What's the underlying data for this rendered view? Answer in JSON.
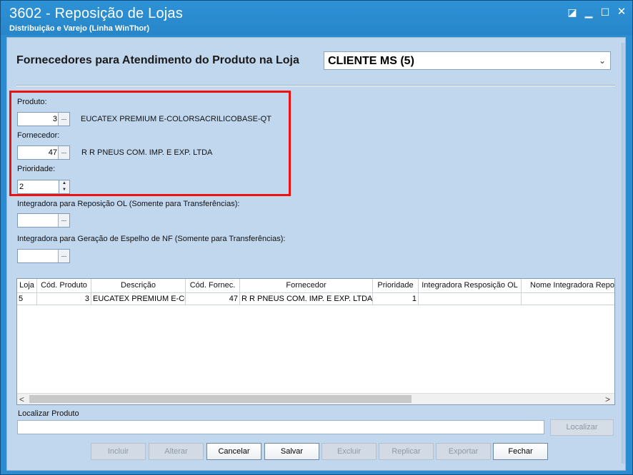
{
  "window": {
    "title": "3602 - Reposição de Lojas",
    "subtitle": "Distribuição e Varejo (Linha WinThor)",
    "controls": {
      "restore": "◪",
      "minimize": "▁",
      "maximize": "☐",
      "close": "✕"
    }
  },
  "header": {
    "title": "Fornecedores para Atendimento do Produto na Loja",
    "store_select": {
      "value": "CLIENTE MS (5)",
      "arrow": "⌄"
    }
  },
  "form": {
    "produto": {
      "label": "Produto:",
      "code": "3",
      "description": "EUCATEX PREMIUM E-COLORSACRILICOBASE-QT"
    },
    "fornecedor": {
      "label": "Fornecedor:",
      "code": "47",
      "description": "R R PNEUS COM. IMP. E EXP. LTDA"
    },
    "prioridade": {
      "label": "Prioridade:",
      "value": "2"
    },
    "integradora_ol": {
      "label": "Integradora para Reposição OL (Somente para Transferências):",
      "code": ""
    },
    "integradora_nf": {
      "label": "Integradora para Geração de Espelho de NF  (Somente para Transferências):",
      "code": ""
    },
    "ellipsis": "...",
    "spin_up": "▲",
    "spin_down": "▼"
  },
  "grid": {
    "columns": [
      "Loja",
      "Cód. Produto",
      "Descrição",
      "Cód. Fornec.",
      "Fornecedor",
      "Prioridade",
      "Integradora Resposição OL",
      "Nome Integradora Reposi"
    ],
    "rows": [
      [
        "5",
        "3",
        "EUCATEX PREMIUM E-COL",
        "47",
        "R R PNEUS COM. IMP. E EXP. LTDA",
        "1",
        "",
        ""
      ]
    ],
    "scroll_left": "<",
    "scroll_right": ">"
  },
  "search": {
    "label": "Localizar Produto",
    "value": "",
    "button": "Localizar"
  },
  "actions": {
    "incluir": "Incluir",
    "alterar": "Alterar",
    "cancelar": "Cancelar",
    "salvar": "Salvar",
    "excluir": "Excluir",
    "replicar": "Replicar",
    "exportar": "Exportar",
    "fechar": "Fechar"
  },
  "colors": {
    "titlebar": "#2b8dd0",
    "client_bg": "#c0d7ee",
    "highlight": "#ee1111"
  }
}
